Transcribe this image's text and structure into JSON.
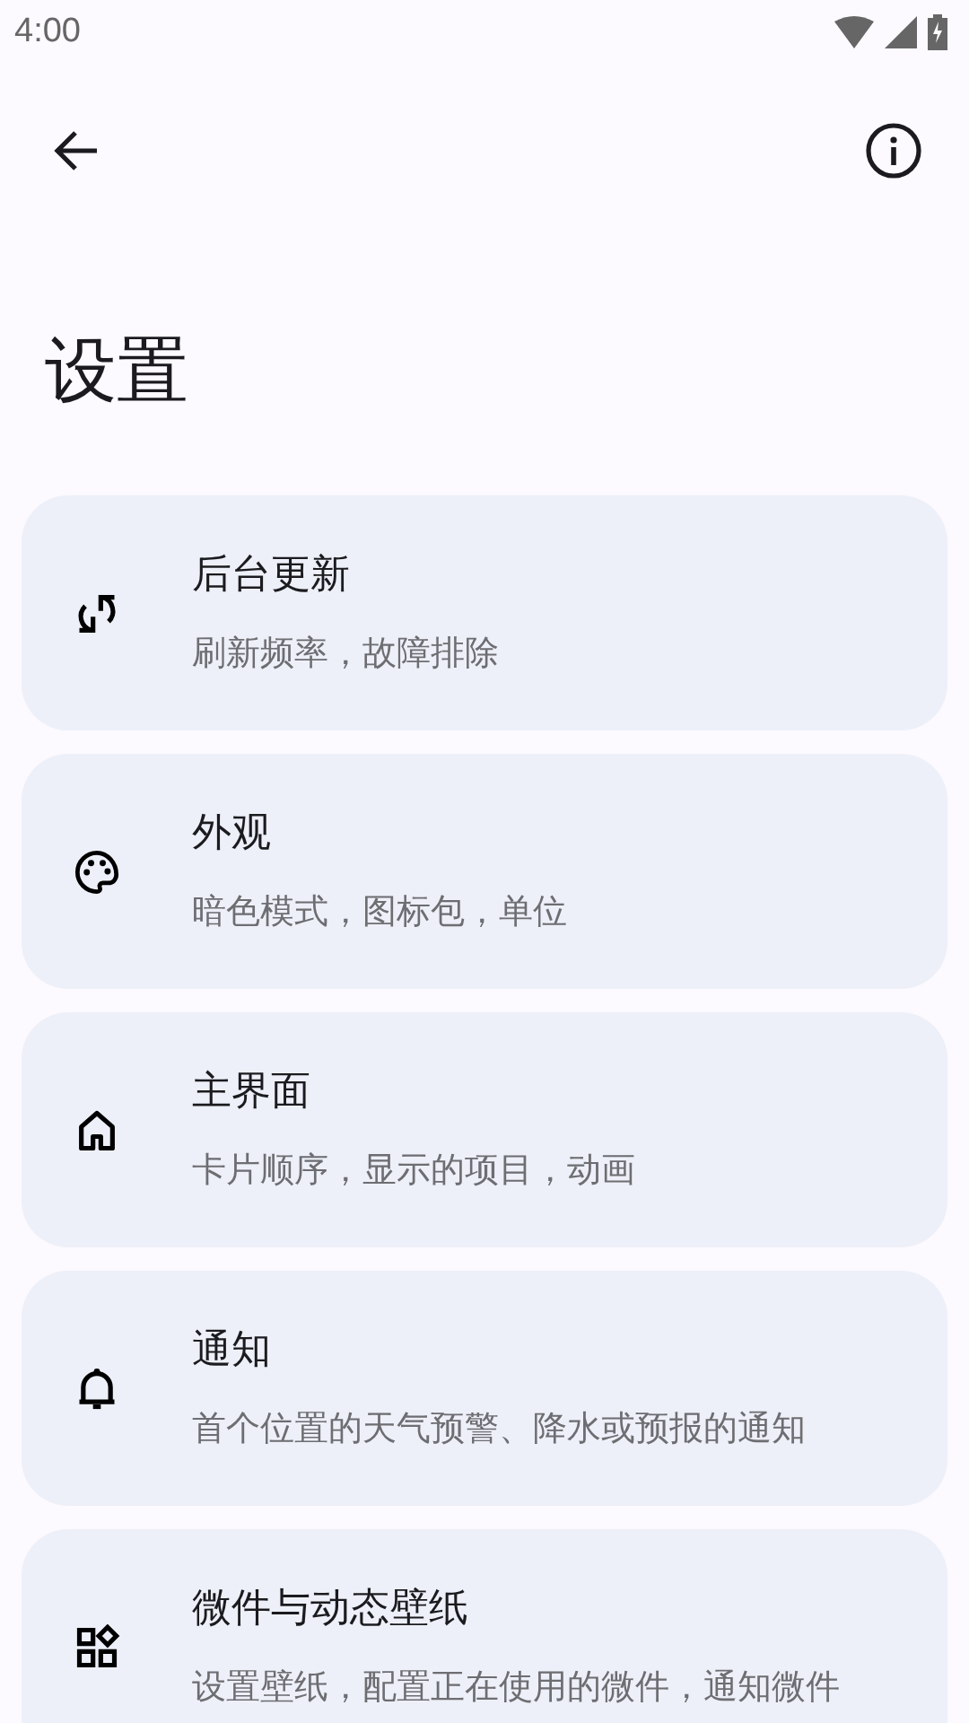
{
  "status_bar": {
    "time": "4:00"
  },
  "app_bar": {
    "title": "设置"
  },
  "items": [
    {
      "title": "后台更新",
      "subtitle": "刷新频率，故障排除"
    },
    {
      "title": "外观",
      "subtitle": "暗色模式，图标包，单位"
    },
    {
      "title": "主界面",
      "subtitle": "卡片顺序，显示的项目，动画"
    },
    {
      "title": "通知",
      "subtitle": "首个位置的天气预警、降水或预报的通知"
    },
    {
      "title": "微件与动态壁纸",
      "subtitle": "设置壁纸，配置正在使用的微件，通知微件"
    }
  ]
}
